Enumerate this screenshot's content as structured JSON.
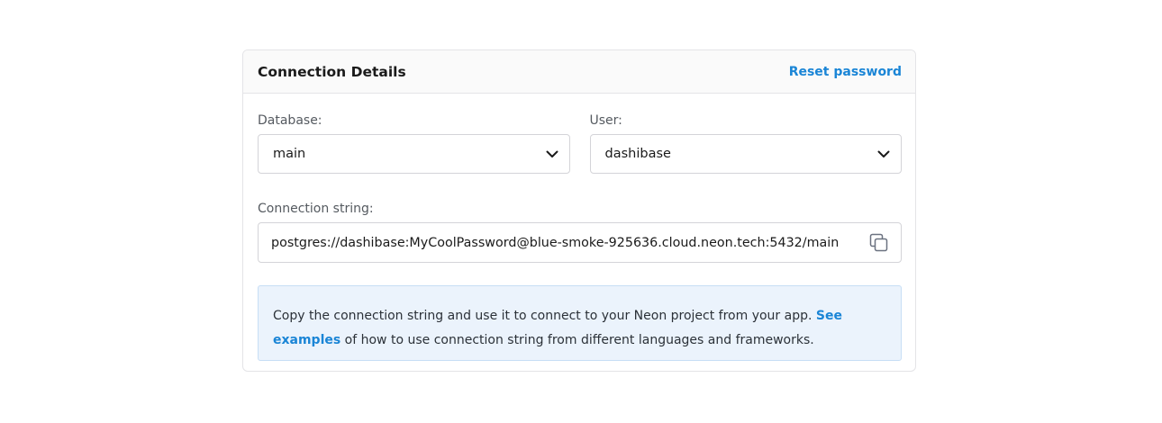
{
  "card": {
    "title": "Connection Details",
    "reset_password_label": "Reset password"
  },
  "database": {
    "label": "Database:",
    "value": "main"
  },
  "user": {
    "label": "User:",
    "value": "dashibase"
  },
  "connection": {
    "label": "Connection string:",
    "value": "postgres://dashibase:MyCoolPassword@blue-smoke-925636.cloud.neon.tech:5432/main"
  },
  "info": {
    "text_before": "Copy the connection string and use it to connect to your Neon project from your app.",
    "link_label": "See examples",
    "text_after": "of how to use connection string from different languages and frameworks."
  },
  "icons": {
    "select_chevron": "chevron-down-icon",
    "copy": "copy-icon"
  },
  "colors": {
    "accent": "#1a85d6",
    "info_background": "#ebf3fc",
    "border": "#e4e4e7"
  }
}
